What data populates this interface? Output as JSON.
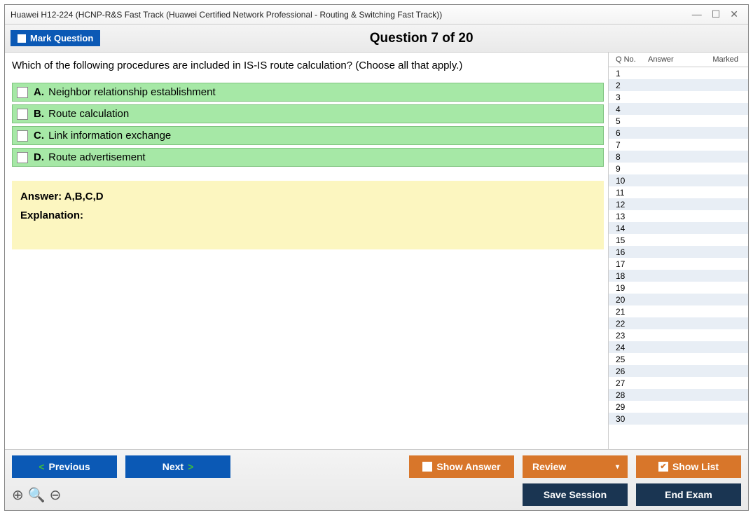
{
  "window": {
    "title": "Huawei H12-224 (HCNP-R&S Fast Track (Huawei Certified Network Professional - Routing & Switching Fast Track))"
  },
  "header": {
    "mark_label": "Mark Question",
    "progress": "Question 7 of 20"
  },
  "question": {
    "text": "Which of the following procedures are included in IS-IS route calculation? (Choose all that apply.)",
    "options": [
      {
        "letter": "A.",
        "text": "Neighbor relationship establishment"
      },
      {
        "letter": "B.",
        "text": "Route calculation"
      },
      {
        "letter": "C.",
        "text": "Link information exchange"
      },
      {
        "letter": "D.",
        "text": "Route advertisement"
      }
    ]
  },
  "answer_panel": {
    "answer": "Answer: A,B,C,D",
    "explanation": "Explanation:"
  },
  "sidebar": {
    "headers": {
      "qno": "Q No.",
      "answer": "Answer",
      "marked": "Marked"
    },
    "rows": [
      "1",
      "2",
      "3",
      "4",
      "5",
      "6",
      "7",
      "8",
      "9",
      "10",
      "11",
      "12",
      "13",
      "14",
      "15",
      "16",
      "17",
      "18",
      "19",
      "20",
      "21",
      "22",
      "23",
      "24",
      "25",
      "26",
      "27",
      "28",
      "29",
      "30"
    ]
  },
  "footer": {
    "previous": "Previous",
    "next": "Next",
    "show_answer": "Show Answer",
    "review": "Review",
    "show_list": "Show List",
    "save_session": "Save Session",
    "end_exam": "End Exam"
  }
}
